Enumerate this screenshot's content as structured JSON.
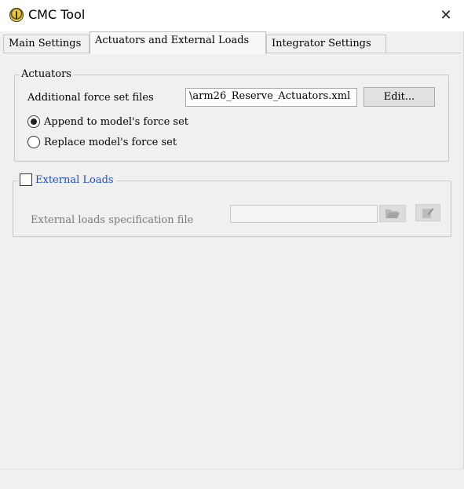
{
  "window": {
    "title": "CMC Tool",
    "close_glyph": "✕"
  },
  "tabs": [
    {
      "label": "Main Settings"
    },
    {
      "label": "Actuators and External Loads"
    },
    {
      "label": "Integrator Settings"
    }
  ],
  "actuators": {
    "legend": "Actuators",
    "force_set_label": "Additional force set files",
    "force_set_value": "\\arm26_Reserve_Actuators.xml",
    "edit_button": "Edit...",
    "radio_append": "Append to model's force set",
    "radio_replace": "Replace model's force set",
    "selected": "append"
  },
  "external_loads": {
    "legend": "External Loads",
    "checked": false,
    "spec_label": "External loads specification file",
    "spec_value": "",
    "icons": {
      "browse": "folder-open-icon",
      "edit": "edit-file-icon"
    }
  },
  "colors": {
    "accent_link": "#1d4ec4",
    "disabled_text": "#7a7a7a"
  }
}
